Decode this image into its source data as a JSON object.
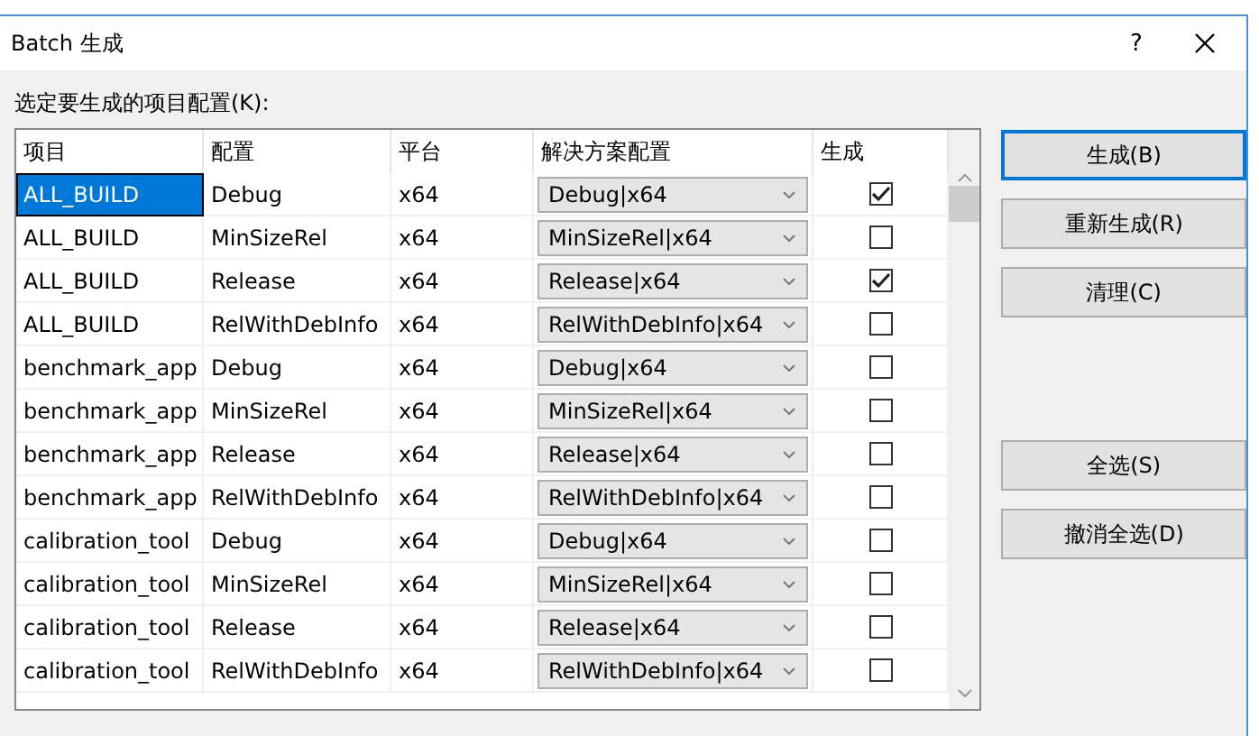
{
  "window": {
    "title": "Batch 生成",
    "help": "?"
  },
  "prompt": "选定要生成的项目配置(K):",
  "table": {
    "columns": [
      "项目",
      "配置",
      "平台",
      "解决方案配置",
      "生成"
    ],
    "rows": [
      {
        "project": "ALL_BUILD",
        "config": "Debug",
        "platform": "x64",
        "solution_config": "Debug|x64",
        "build": true,
        "selected": true
      },
      {
        "project": "ALL_BUILD",
        "config": "MinSizeRel",
        "platform": "x64",
        "solution_config": "MinSizeRel|x64",
        "build": false,
        "selected": false
      },
      {
        "project": "ALL_BUILD",
        "config": "Release",
        "platform": "x64",
        "solution_config": "Release|x64",
        "build": true,
        "selected": false
      },
      {
        "project": "ALL_BUILD",
        "config": "RelWithDebInfo",
        "platform": "x64",
        "solution_config": "RelWithDebInfo|x64",
        "build": false,
        "selected": false
      },
      {
        "project": "benchmark_app",
        "config": "Debug",
        "platform": "x64",
        "solution_config": "Debug|x64",
        "build": false,
        "selected": false
      },
      {
        "project": "benchmark_app",
        "config": "MinSizeRel",
        "platform": "x64",
        "solution_config": "MinSizeRel|x64",
        "build": false,
        "selected": false
      },
      {
        "project": "benchmark_app",
        "config": "Release",
        "platform": "x64",
        "solution_config": "Release|x64",
        "build": false,
        "selected": false
      },
      {
        "project": "benchmark_app",
        "config": "RelWithDebInfo",
        "platform": "x64",
        "solution_config": "RelWithDebInfo|x64",
        "build": false,
        "selected": false
      },
      {
        "project": "calibration_tool",
        "config": "Debug",
        "platform": "x64",
        "solution_config": "Debug|x64",
        "build": false,
        "selected": false
      },
      {
        "project": "calibration_tool",
        "config": "MinSizeRel",
        "platform": "x64",
        "solution_config": "MinSizeRel|x64",
        "build": false,
        "selected": false
      },
      {
        "project": "calibration_tool",
        "config": "Release",
        "platform": "x64",
        "solution_config": "Release|x64",
        "build": false,
        "selected": false
      },
      {
        "project": "calibration_tool",
        "config": "RelWithDebInfo",
        "platform": "x64",
        "solution_config": "RelWithDebInfo|x64",
        "build": false,
        "selected": false
      }
    ]
  },
  "buttons": [
    {
      "label": "生成(B)",
      "default": true
    },
    {
      "label": "重新生成(R)",
      "default": false
    },
    {
      "label": "清理(C)",
      "default": false
    }
  ],
  "selection_buttons": [
    {
      "label": "全选(S)",
      "default": false
    },
    {
      "label": "撤消全选(D)",
      "default": false
    }
  ]
}
